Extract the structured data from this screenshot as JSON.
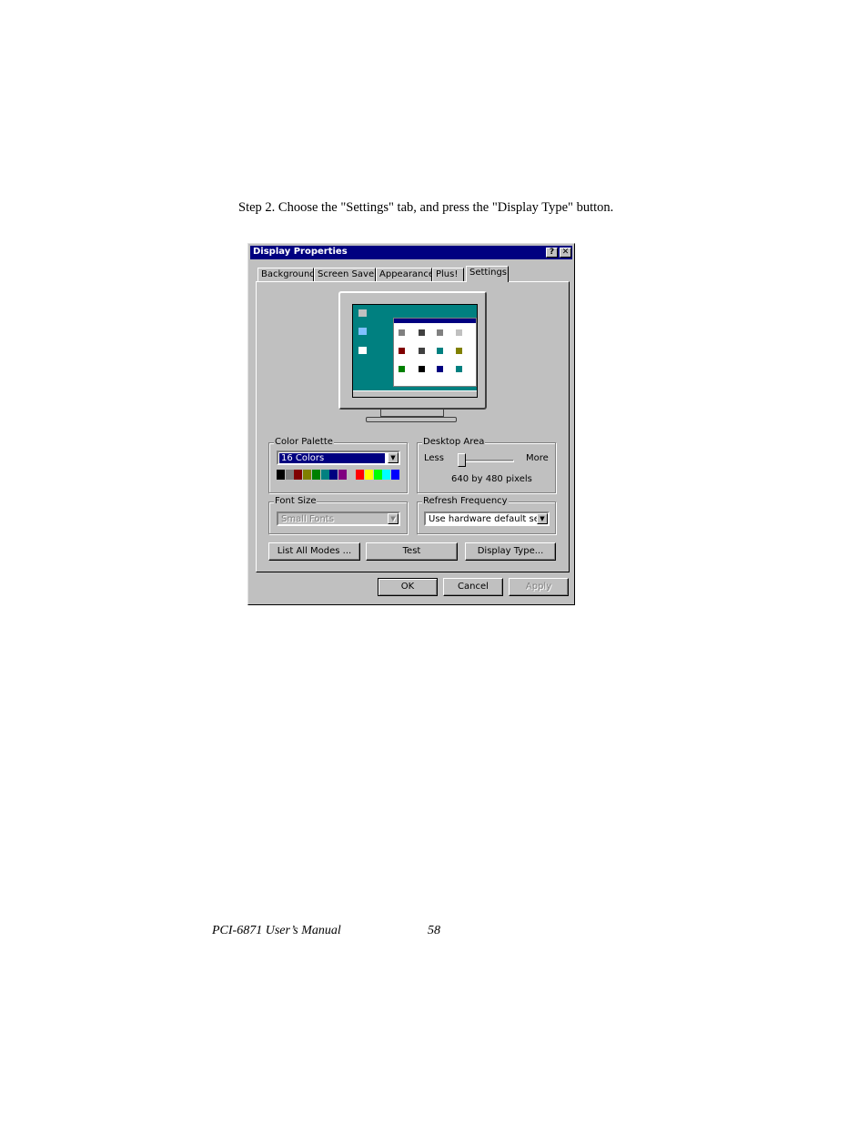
{
  "instruction": "Step 2.  Choose the \"Settings\" tab, and press the \"Display Type\" button.",
  "dialog": {
    "title": "Display Properties",
    "help_button": "?",
    "close_button": "✕",
    "tabs": [
      {
        "label": "Background"
      },
      {
        "label": "Screen Saver"
      },
      {
        "label": "Appearance"
      },
      {
        "label": "Plus!"
      },
      {
        "label": "Settings",
        "active": true
      }
    ],
    "color_palette": {
      "label": "Color Palette",
      "selected": "16 Colors",
      "swatches": [
        "#000000",
        "#808080",
        "#800000",
        "#808000",
        "#008000",
        "#008080",
        "#000080",
        "#800080",
        "#c0c0c0",
        "#ff0000",
        "#ffff00",
        "#00ff00",
        "#00ffff",
        "#0000ff"
      ]
    },
    "desktop_area": {
      "label": "Desktop Area",
      "less": "Less",
      "more": "More",
      "value_text": "640 by 480 pixels",
      "slider_level": 0
    },
    "font_size": {
      "label": "Font Size",
      "selected": "Small Fonts",
      "disabled": true
    },
    "refresh_frequency": {
      "label": "Refresh Frequency",
      "selected": "Use hardware default settin"
    },
    "buttons": {
      "list_all_modes": "List All Modes ...",
      "test": "Test",
      "display_type": "Display Type...",
      "ok": "OK",
      "cancel": "Cancel",
      "apply": "Apply"
    },
    "colors": {
      "titlebar": "#000080",
      "face": "#c0c0c0",
      "desktop": "#008080"
    }
  },
  "footer": {
    "title": "PCI-6871 User’s Manual",
    "page": "58"
  }
}
